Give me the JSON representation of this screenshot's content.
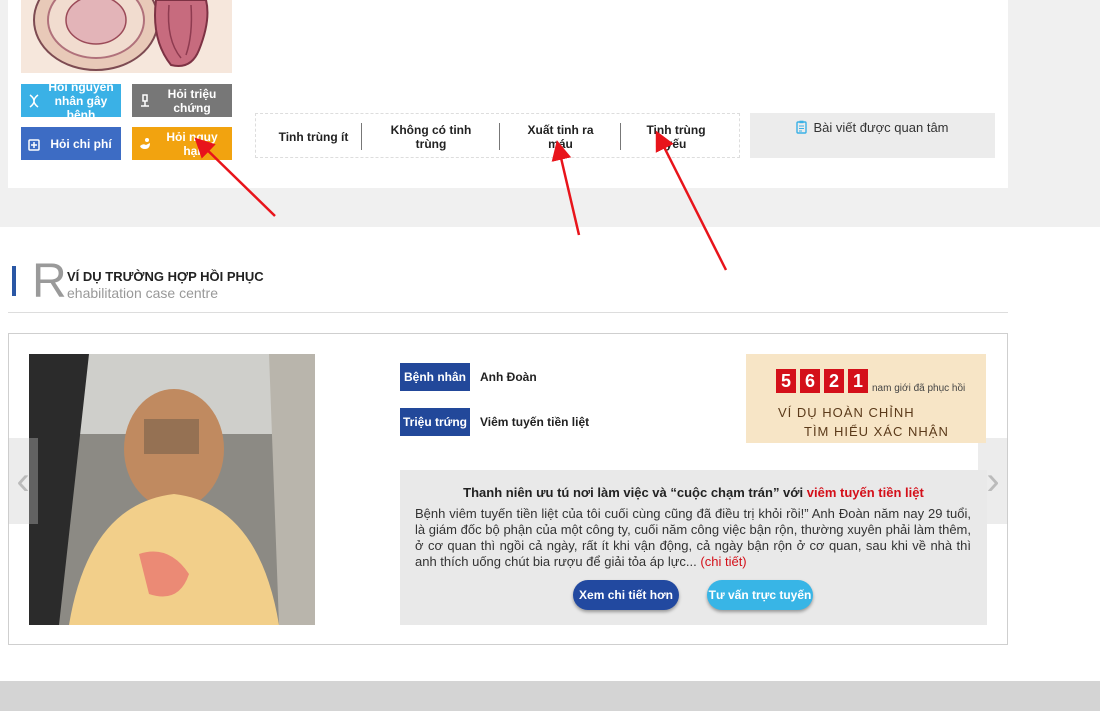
{
  "quick_buttons": [
    {
      "label": "Hỏi nguyên nhân gây bệnh",
      "color": "#3ab1e6",
      "icon": "dna-icon"
    },
    {
      "label": "Hỏi triệu chứng",
      "color": "#777777",
      "icon": "microscope-icon"
    },
    {
      "label": "Hỏi chi phí",
      "color": "#3d6cc4",
      "icon": "wallet-icon"
    },
    {
      "label": "Hỏi nguy hại",
      "color": "#f2a30f",
      "icon": "hand-icon"
    }
  ],
  "tabs": [
    "Tinh trùng ít",
    "Không có tinh trùng",
    "Xuất tinh ra máu",
    "Tinh trùng yếu"
  ],
  "article_box": {
    "title": "Bài viết được quan tâm"
  },
  "section": {
    "letter": "R",
    "title": "VÍ DỤ TRƯỜNG HỢP HỒI PHỤC",
    "subtitle": "ehabilitation case centre"
  },
  "case": {
    "patient_label": "Bệnh nhân",
    "patient_value": "Anh Đoàn",
    "symptom_label": "Triệu trứng",
    "symptom_value": "Viêm tuyến tiền liệt"
  },
  "counter": {
    "digits": [
      "5",
      "6",
      "2",
      "1"
    ],
    "label": "nam giới đã phục hồi",
    "banner_line1": "VÍ DỤ HOÀN CHỈNH",
    "banner_line2": "TÌM HIỂU XÁC NHẬN"
  },
  "story": {
    "title_prefix": "Thanh niên ưu tú nơi làm việc và “cuộc chạm trán” với",
    "title_highlight": "viêm tuyến tiền liệt",
    "text": "Bệnh viêm tuyến tiền liệt của tôi cuối cùng cũng đã điều trị khỏi rồi!” Anh Đoàn năm nay 29 tuổi, là giám đốc bộ phận của một công ty, cuối năm công việc bận rộn, thường xuyên phải làm thêm, ở cơ quan thì ngồi cả ngày, rất ít khi vận động, cả ngày bận rộn ở cơ quan, sau khi về nhà thì anh thích uống chút bia rượu để giải tỏa áp lực...",
    "more_link": "(chi tiết)"
  },
  "buttons": {
    "detail": "Xem chi tiết hơn",
    "consult": "Tư vấn trực tuyến"
  },
  "nav": {
    "prev": "‹",
    "next": "›"
  },
  "colors": {
    "accent_blue": "#22489a",
    "accent_red": "#d4101a",
    "pill_blue": "#2249a0",
    "pill_cyan": "#38b5e6"
  }
}
